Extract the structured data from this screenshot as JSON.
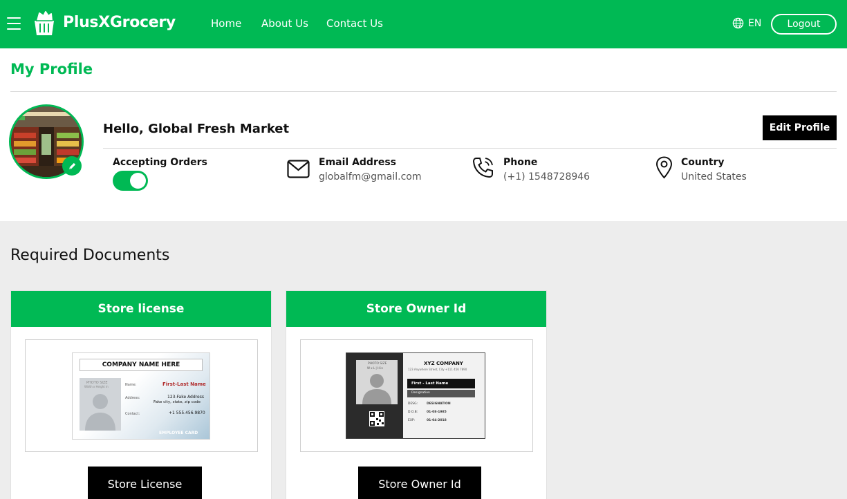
{
  "brand": {
    "name": "PlusXGrocery"
  },
  "nav": {
    "items": [
      "Home",
      "About Us",
      "Contact Us"
    ]
  },
  "header": {
    "language": "EN",
    "logout_label": "Logout"
  },
  "profile": {
    "page_title": "My Profile",
    "greeting": "Hello, Global Fresh Market",
    "edit_label": "Edit Profile",
    "accepting_orders_label": "Accepting Orders",
    "accepting_orders_on": true,
    "email_label": "Email Address",
    "email_value": "globalfm@gmail.com",
    "phone_label": "Phone",
    "phone_value": "(+1) 1548728946",
    "country_label": "Country",
    "country_value": "United States"
  },
  "documents": {
    "title": "Required Documents",
    "cards": [
      {
        "header": "Store license",
        "button": "Store License",
        "preview": {
          "company": "COMPANY NAME HERE",
          "photo_line1": "PHOTO SIZE",
          "photo_line2": "Width x Height in",
          "name_label": "Name:",
          "name_value": "First-Last Name",
          "address_label": "Address:",
          "address_line1": "123-Fake Address",
          "address_line2": "Fake city, state, zip code",
          "contact_label": "Contact:",
          "contact_value": "+1 555.456.9870",
          "footer": "EMPLOYEE CARD"
        }
      },
      {
        "header": "Store Owner Id",
        "button": "Store Owner Id",
        "preview": {
          "photo_line1": "PHOTO SIZE",
          "photo_line2": "W x L | H in",
          "company": "XYZ COMPANY",
          "address": "123 Anywhere Street, City +111 456 7890",
          "name": "First - Last Name",
          "designation": "Designation",
          "desg_label": "DESG:",
          "desg_value": "DESIGNATION",
          "dob_label": "D.O.B:",
          "dob_value": "01-08-1985",
          "exp_label": "EXP:",
          "exp_value": "01-04-2018"
        }
      }
    ]
  },
  "colors": {
    "accent": "#00b954",
    "dark": "#000000",
    "docs_background": "#ededed"
  },
  "icons": [
    "menu-icon",
    "basket-logo-icon",
    "globe-icon",
    "pencil-icon",
    "envelope-icon",
    "phone-icon",
    "location-pin-icon"
  ]
}
